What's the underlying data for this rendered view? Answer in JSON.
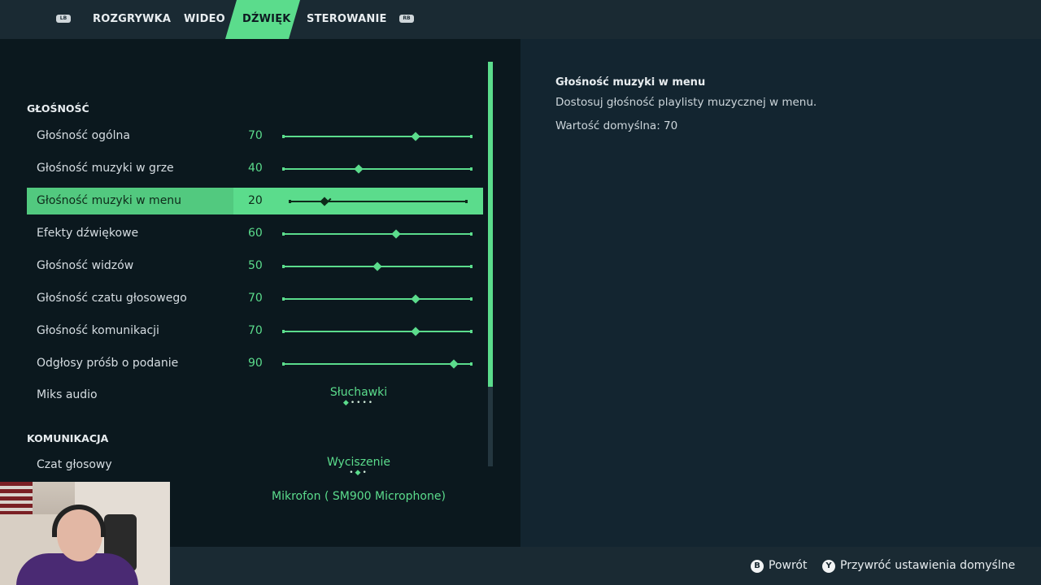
{
  "nav": {
    "left_bumper": "LB",
    "right_bumper": "RB",
    "tabs": [
      {
        "label": "ROZGRYWKA",
        "active": false
      },
      {
        "label": "WIDEO",
        "active": false
      },
      {
        "label": "DŹWIĘK",
        "active": true
      },
      {
        "label": "STEROWANIE",
        "active": false
      }
    ]
  },
  "sections": {
    "volume": "GŁOŚNOŚĆ",
    "communication": "KOMUNIKACJA"
  },
  "settings": [
    {
      "label": "Głośność ogólna",
      "value": 70
    },
    {
      "label": "Głośność muzyki w grze",
      "value": 40
    },
    {
      "label": "Głośność muzyki w menu",
      "value": 20,
      "selected": true
    },
    {
      "label": "Efekty dźwiękowe",
      "value": 60
    },
    {
      "label": "Głośność widzów",
      "value": 50
    },
    {
      "label": "Głośność czatu głosowego",
      "value": 70
    },
    {
      "label": "Głośność komunikacji",
      "value": 70
    },
    {
      "label": "Odgłosy próśb o podanie",
      "value": 90
    }
  ],
  "audio_mix": {
    "label": "Miks audio",
    "value": "Słuchawki",
    "option_count": 5,
    "selected_index": 0
  },
  "voice_chat": {
    "label": "Czat głosowy",
    "value": "Wyciszenie",
    "option_count": 3,
    "selected_index": 1
  },
  "microphone": {
    "value": "Mikrofon ( SM900 Microphone)"
  },
  "description": {
    "title": "Głośność muzyki w menu",
    "text": "Dostosuj głośność playlisty muzycznej w menu.",
    "default": "Wartość domyślna: 70"
  },
  "footer": {
    "back": {
      "button": "B",
      "label": "Powrót"
    },
    "reset": {
      "button": "Y",
      "label": "Przywróć ustawienia domyślne"
    }
  },
  "colors": {
    "accent": "#5bdc8c",
    "background": "#0b181e",
    "panel": "#132530"
  }
}
